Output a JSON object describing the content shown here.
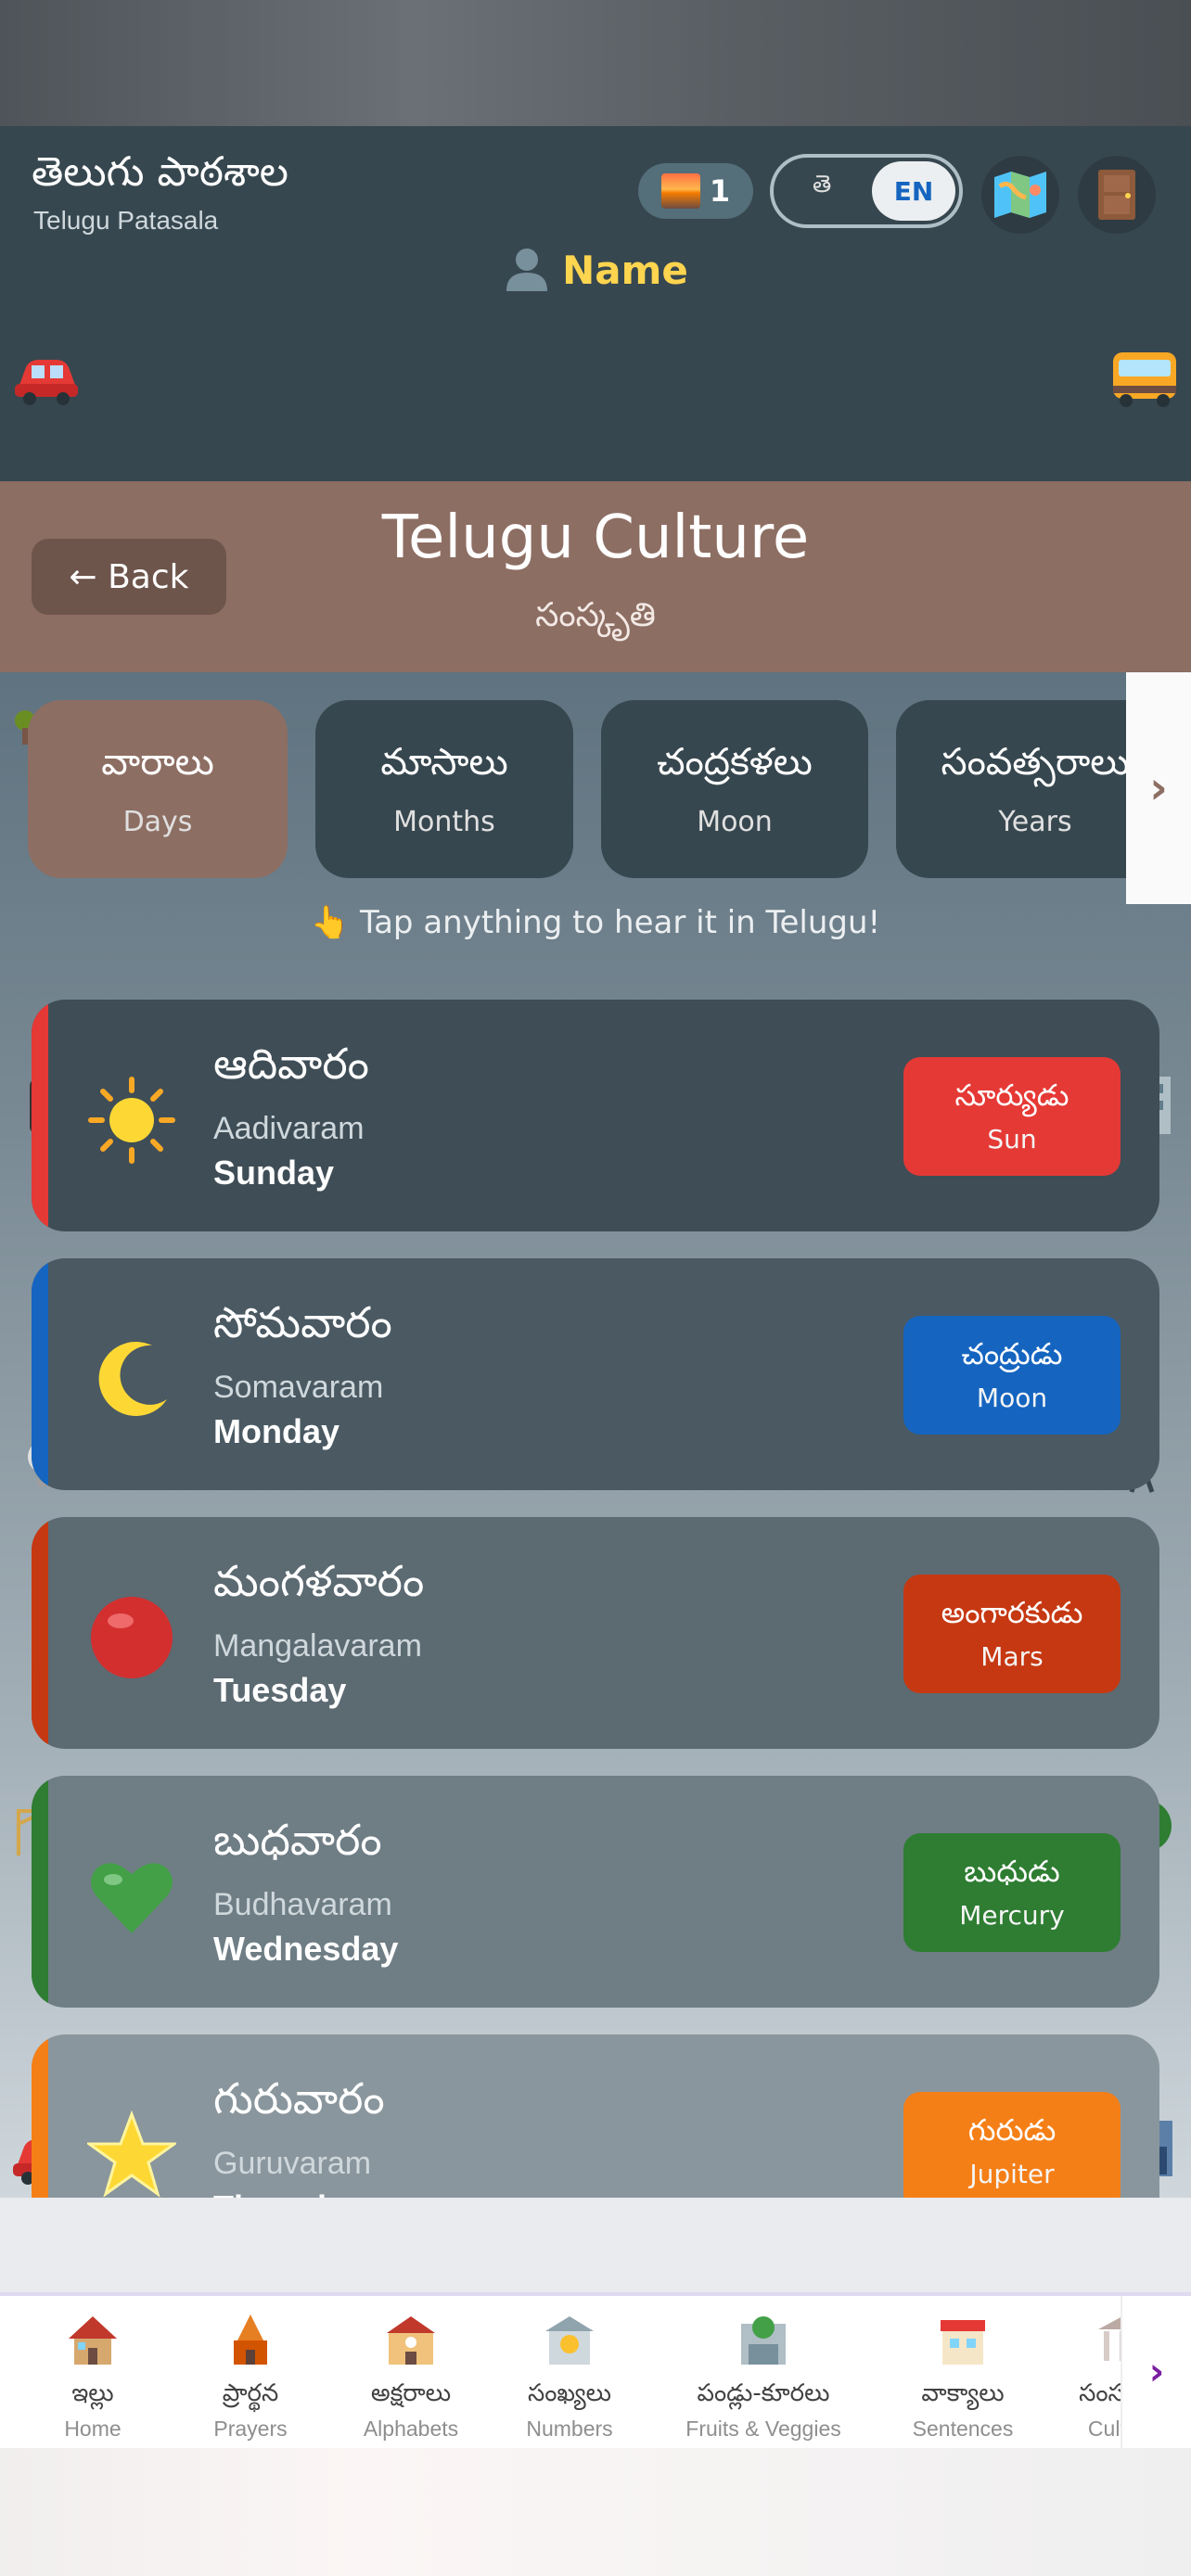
{
  "header": {
    "app_title": "తెలుగు పాఠశాల",
    "app_subtitle": "Telugu Patasala",
    "streak_count": "1",
    "lang_te": "తె",
    "lang_en": "EN",
    "user_name": "Name",
    "icons": [
      "sunrise-icon",
      "map-icon",
      "door-icon",
      "person-icon",
      "car-icon",
      "bus-icon"
    ]
  },
  "culture": {
    "back_label": "← Back",
    "title": "Telugu Culture",
    "subtitle": "సంస్కృతి"
  },
  "tabs": [
    {
      "te": "వారాలు",
      "en": "Days",
      "active": true
    },
    {
      "te": "మాసాలు",
      "en": "Months",
      "active": false
    },
    {
      "te": "చంద్రకళలు",
      "en": "Moon",
      "active": false
    },
    {
      "te": "సంవత్సరాలు",
      "en": "Years",
      "active": false
    }
  ],
  "tabs_more": "›",
  "hint": "👆 Tap anything to hear it in Telugu!",
  "days": [
    {
      "te": "ఆదివారం",
      "translit": "Aadivaram",
      "en": "Sunday",
      "planet_te": "సూర్యుడు",
      "planet_en": "Sun",
      "color": "#e53935",
      "icon": "sun-icon"
    },
    {
      "te": "సోమవారం",
      "translit": "Somavaram",
      "en": "Monday",
      "planet_te": "చంద్రుడు",
      "planet_en": "Moon",
      "color": "#1565c0",
      "icon": "crescent-moon-icon"
    },
    {
      "te": "మంగళవారం",
      "translit": "Mangalavaram",
      "en": "Tuesday",
      "planet_te": "అంగారకుడు",
      "planet_en": "Mars",
      "color": "#c63812",
      "icon": "red-circle-icon"
    },
    {
      "te": "బుధవారం",
      "translit": "Budhavaram",
      "en": "Wednesday",
      "planet_te": "బుధుడు",
      "planet_en": "Mercury",
      "color": "#2e7d32",
      "icon": "green-heart-icon"
    },
    {
      "te": "గురువారం",
      "translit": "Guruvaram",
      "en": "Thursday",
      "planet_te": "గురుడు",
      "planet_en": "Jupiter",
      "color": "#f57f17",
      "icon": "star-icon"
    }
  ],
  "nav": [
    {
      "te": "ఇల్లు",
      "en": "Home",
      "icon": "house-icon"
    },
    {
      "te": "ప్రార్థన",
      "en": "Prayers",
      "icon": "temple-icon"
    },
    {
      "te": "అక్షరాలు",
      "en": "Alphabets",
      "icon": "school-icon"
    },
    {
      "te": "సంఖ్యలు",
      "en": "Numbers",
      "icon": "bank-icon"
    },
    {
      "te": "పండ్లు-కూరలు",
      "en": "Fruits & Veggies",
      "icon": "store-icon"
    },
    {
      "te": "వాక్యాలు",
      "en": "Sentences",
      "icon": "post-office-icon"
    },
    {
      "te": "సంస్కృతి",
      "en": "Culture",
      "icon": "museum-icon"
    }
  ],
  "nav_more": "›"
}
